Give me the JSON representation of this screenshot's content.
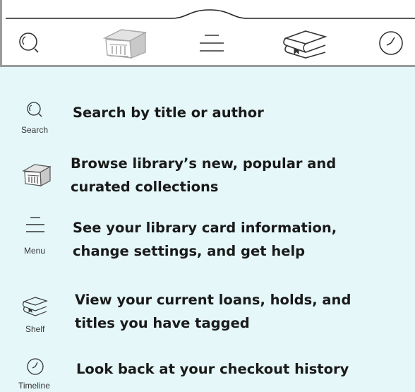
{
  "nav_bar": {
    "items": [
      {
        "icon": "search-icon"
      },
      {
        "icon": "library-building-icon"
      },
      {
        "icon": "menu-icon"
      },
      {
        "icon": "shelf-books-icon"
      },
      {
        "icon": "timeline-clock-icon"
      }
    ],
    "colors": {
      "border": "#9a9a9a",
      "icon": "#333333",
      "library_icon": "#a8a8a8"
    }
  },
  "legend": {
    "background": "#e5f7f9",
    "items": [
      {
        "icon": "search-icon",
        "label": "Search",
        "description_lines": [
          "Search by title or author"
        ]
      },
      {
        "icon": "library-building-icon",
        "label": "",
        "description_lines": [
          "Browse library’s new, popular and",
          "curated collections"
        ]
      },
      {
        "icon": "menu-icon",
        "label": "Menu",
        "description_lines": [
          "See your library card information,",
          "change settings, and get help"
        ]
      },
      {
        "icon": "shelf-books-icon",
        "label": "Shelf",
        "description_lines": [
          "View your current loans, holds, and",
          "titles you have tagged"
        ]
      },
      {
        "icon": "timeline-clock-icon",
        "label": "Timeline",
        "description_lines": [
          "Look back at your checkout history"
        ]
      }
    ]
  }
}
